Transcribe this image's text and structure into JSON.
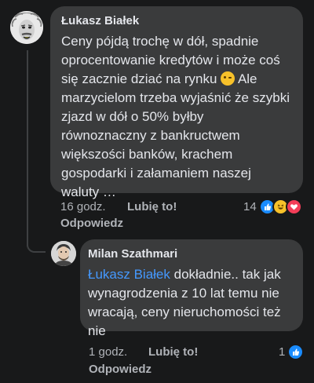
{
  "comments": [
    {
      "author": "Łukasz Białek",
      "text_part1": "Ceny pójdą trochę w dół, spadnie oprocentowanie kredytów i może coś się zacznie dziać na rynku ",
      "emoji": "winking-face",
      "text_part2": " Ale marzycielom trzeba wyjaśnić że szybki zjazd w dół o 50% byłby równoznaczny z bankructwem większości banków, krachem gospodarki i załamaniem naszej waluty …",
      "time": "16 godz.",
      "like_action": "Lubię to!",
      "reply_action": "Odpowiedz",
      "reaction_count": "14",
      "reactions": [
        "like",
        "haha",
        "love"
      ]
    },
    {
      "author": "Milan Szathmari",
      "mention": "Łukasz Białek",
      "text": " dokładnie.. tak jak wynagrodzenia z 10 lat temu nie wracają, ceny nieruchomości też nie",
      "time": "1 godz.",
      "like_action": "Lubię to!",
      "reply_action": "Odpowiedz",
      "reaction_count": "1",
      "reactions": [
        "like"
      ]
    }
  ],
  "colors": {
    "background": "#18191a",
    "bubble": "#3a3b3c",
    "text": "#e4e6eb",
    "meta": "#b0b3b8",
    "mention": "#4599ff",
    "like": "#1a8cff",
    "haha": "#f7c12a",
    "love": "#f33e58"
  }
}
